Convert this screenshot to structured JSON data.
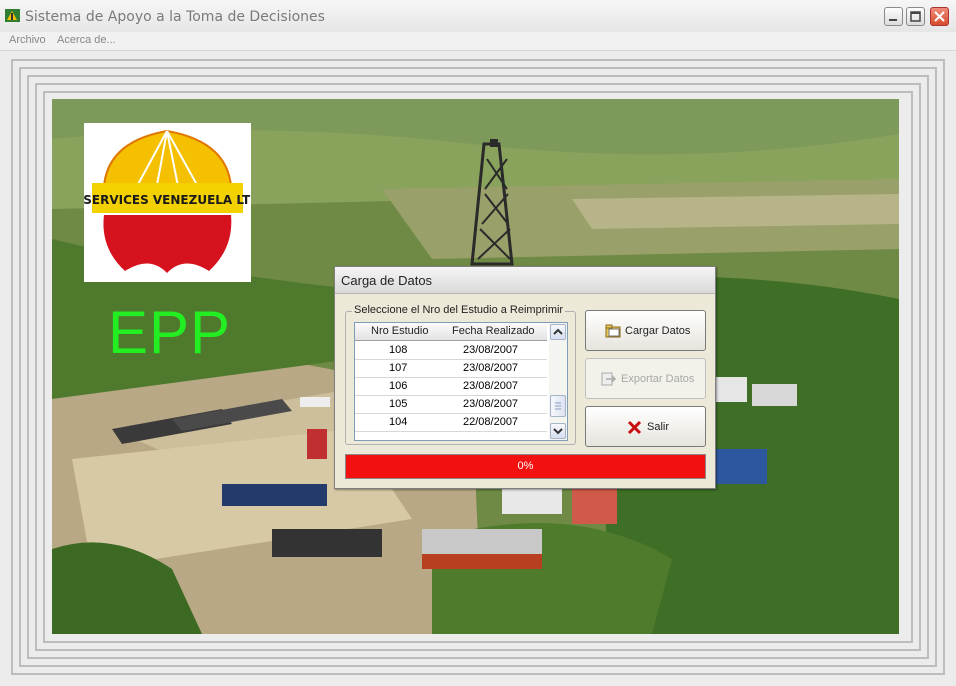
{
  "window": {
    "title": "Sistema de Apoyo a la Toma de Decisiones",
    "controls": [
      "minimize-icon",
      "maximize-icon",
      "close-icon"
    ]
  },
  "menu": {
    "items": [
      {
        "label": "Archivo"
      },
      {
        "label": "Acerca de..."
      }
    ]
  },
  "background": {
    "logo_text": "CHPC SERVICES VENEZUELA LTD, S.A",
    "brand_label": "EPP",
    "brand_color": "#22ee22"
  },
  "dialog": {
    "title": "Carga de Datos",
    "group_label": "Seleccione el Nro del Estudio a Reimprimir",
    "columns": [
      "Nro Estudio",
      "Fecha Realizado"
    ],
    "rows": [
      [
        "108",
        "23/08/2007"
      ],
      [
        "107",
        "23/08/2007"
      ],
      [
        "106",
        "23/08/2007"
      ],
      [
        "105",
        "23/08/2007"
      ],
      [
        "104",
        "22/08/2007"
      ]
    ],
    "buttons": {
      "load": "Cargar Datos",
      "export": "Exportar Datos",
      "exit": "Salir"
    },
    "progress": {
      "label": "0%",
      "value": 0,
      "color": "#f31010"
    }
  }
}
